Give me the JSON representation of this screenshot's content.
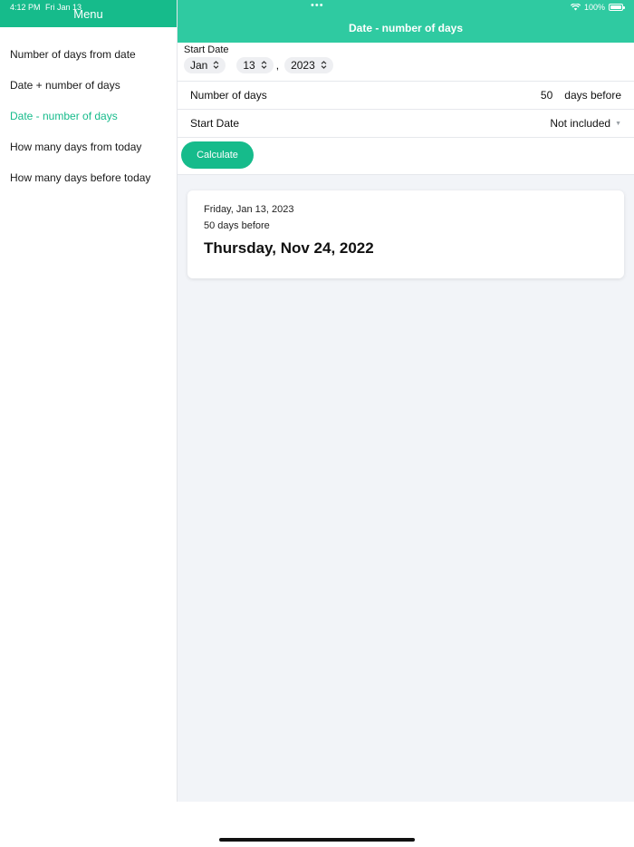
{
  "status": {
    "time": "4:12 PM",
    "date": "Fri Jan 13",
    "battery": "100%"
  },
  "sidebar": {
    "title": "Menu",
    "items": [
      {
        "label": "Number of days from date"
      },
      {
        "label": "Date + number of days"
      },
      {
        "label": "Date - number of days",
        "active": true
      },
      {
        "label": "How many days from today"
      },
      {
        "label": "How many days before today"
      }
    ]
  },
  "nav": {
    "title": "Date - number of days"
  },
  "form": {
    "start_date_label": "Start Date",
    "month": "Jan",
    "day": "13",
    "comma": ",",
    "year": "2023",
    "number_of_days_label": "Number of days",
    "number_of_days_value": "50",
    "direction": "days before",
    "start_date_option_label": "Start Date",
    "start_date_option_value": "Not included",
    "calculate_label": "Calculate"
  },
  "result": {
    "from_date": "Friday, Jan 13, 2023",
    "offset": "50 days before",
    "answer": "Thursday, Nov 24, 2022"
  },
  "colors": {
    "accent": "#16bb8b",
    "nav_bar": "#2fcaa1",
    "background": "#f2f4f8"
  }
}
